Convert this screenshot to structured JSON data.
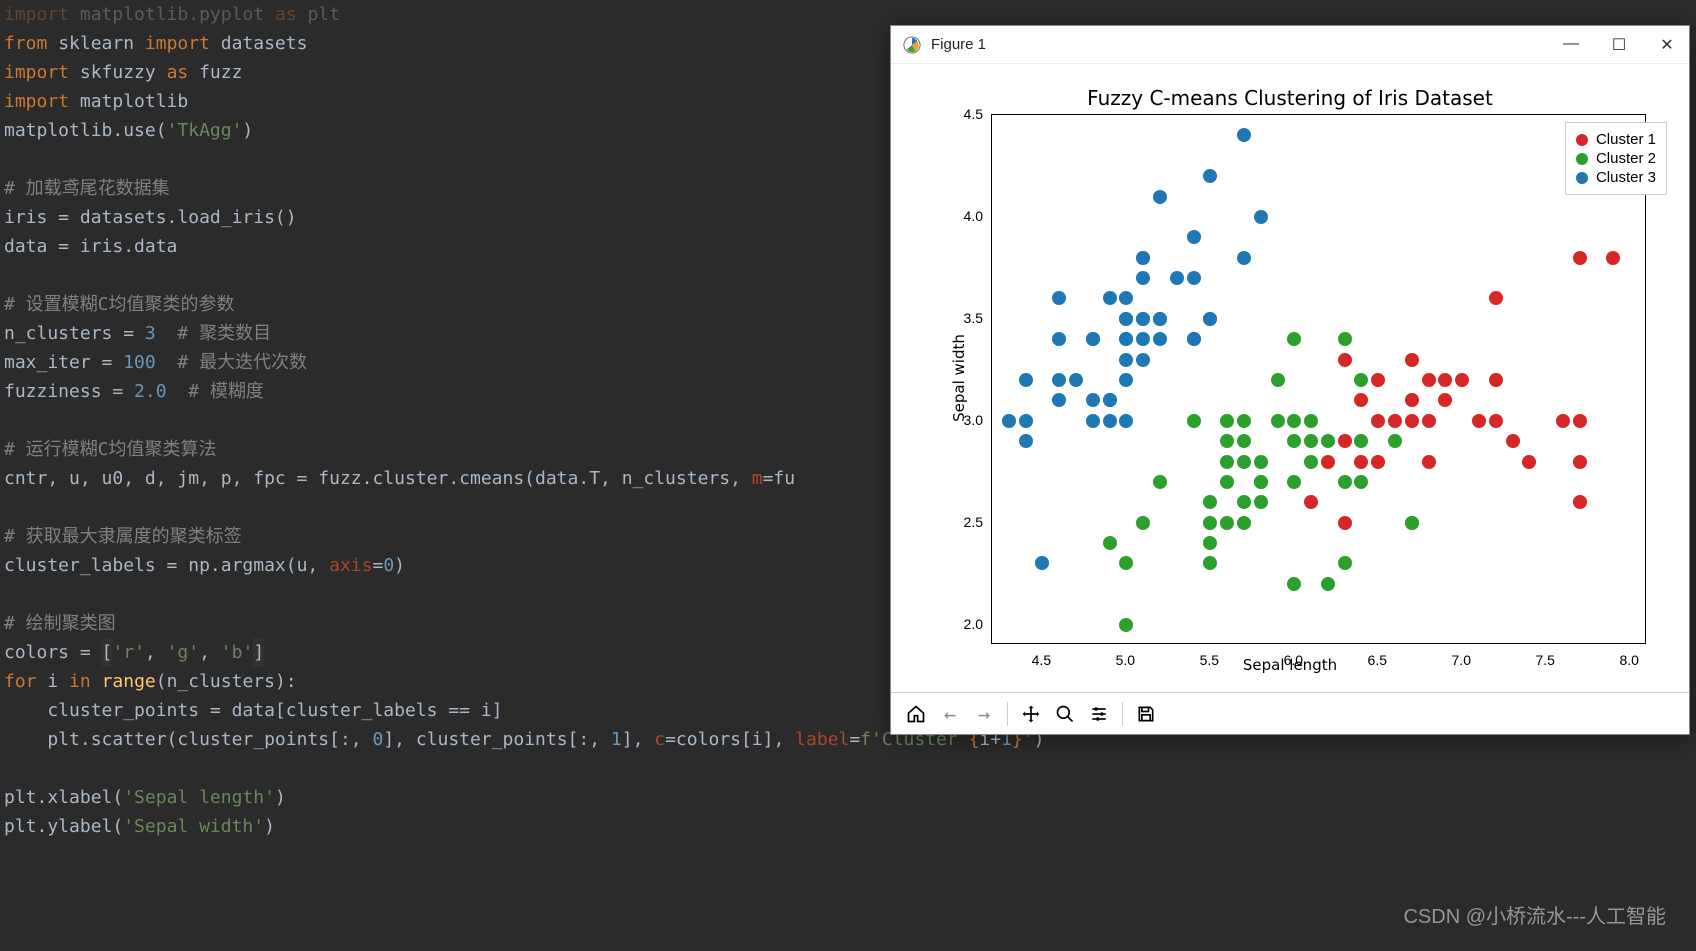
{
  "code": {
    "lines": [
      {
        "t": "import matplotlib.pyplot as plt",
        "tokens": [
          [
            "import ",
            "kw"
          ],
          [
            "matplotlib.pyplot ",
            ""
          ],
          [
            "as ",
            "kw"
          ],
          [
            "plt",
            ""
          ]
        ]
      },
      {
        "t": "from sklearn import datasets",
        "tokens": [
          [
            "from ",
            "kw"
          ],
          [
            "sklearn ",
            ""
          ],
          [
            "import ",
            "kw"
          ],
          [
            "datasets",
            ""
          ]
        ]
      },
      {
        "t": "import skfuzzy as fuzz",
        "tokens": [
          [
            "import ",
            "kw"
          ],
          [
            "skfuzzy ",
            ""
          ],
          [
            "as ",
            "kw"
          ],
          [
            "fuzz",
            ""
          ]
        ]
      },
      {
        "t": "import matplotlib",
        "tokens": [
          [
            "import ",
            "kw"
          ],
          [
            "matplotlib",
            ""
          ]
        ]
      },
      {
        "t": "matplotlib.use('TkAgg')",
        "tokens": [
          [
            "matplotlib.use(",
            ""
          ],
          [
            "'TkAgg'",
            "str"
          ],
          [
            ")",
            ""
          ]
        ]
      },
      {
        "t": "",
        "tokens": []
      },
      {
        "t": "# 加载鸢尾花数据集",
        "tokens": [
          [
            "# 加载鸢尾花数据集",
            "cmt"
          ]
        ]
      },
      {
        "t": "iris = datasets.load_iris()",
        "tokens": [
          [
            "iris = datasets.load_iris()",
            ""
          ]
        ]
      },
      {
        "t": "data = iris.data",
        "tokens": [
          [
            "data = iris.data",
            ""
          ]
        ]
      },
      {
        "t": "",
        "tokens": []
      },
      {
        "t": "# 设置模糊C均值聚类的参数",
        "tokens": [
          [
            "# 设置模糊C均值聚类的参数",
            "cmt"
          ]
        ]
      },
      {
        "t": "n_clusters = 3  # 聚类数目",
        "tokens": [
          [
            "n_clusters = ",
            ""
          ],
          [
            "3",
            "num"
          ],
          [
            "  ",
            ""
          ],
          [
            "# 聚类数目",
            "cmt"
          ]
        ]
      },
      {
        "t": "max_iter = 100  # 最大迭代次数",
        "tokens": [
          [
            "max_iter = ",
            ""
          ],
          [
            "100",
            "num"
          ],
          [
            "  ",
            ""
          ],
          [
            "# 最大迭代次数",
            "cmt"
          ]
        ]
      },
      {
        "t": "fuzziness = 2.0  # 模糊度",
        "tokens": [
          [
            "fuzziness = ",
            ""
          ],
          [
            "2.0",
            "num"
          ],
          [
            "  ",
            ""
          ],
          [
            "# 模糊度",
            "cmt"
          ]
        ]
      },
      {
        "t": "",
        "tokens": []
      },
      {
        "t": "# 运行模糊C均值聚类算法",
        "tokens": [
          [
            "# 运行模糊C均值聚类算法",
            "cmt"
          ]
        ]
      },
      {
        "t": "cntr, u, u0, d, jm, p, fpc = fuzz.cluster.cmeans(data.T, n_clusters, m=fu",
        "tokens": [
          [
            "cntr, u, u0, d, jm, p, fpc = fuzz.cluster.cmeans(data.T, n_clusters, ",
            ""
          ],
          [
            "m",
            "param"
          ],
          [
            "=fu",
            ""
          ]
        ]
      },
      {
        "t": "",
        "tokens": []
      },
      {
        "t": "# 获取最大隶属度的聚类标签",
        "tokens": [
          [
            "# 获取最大隶属度的聚类标签",
            "cmt"
          ]
        ]
      },
      {
        "t": "cluster_labels = np.argmax(u, axis=0)",
        "tokens": [
          [
            "cluster_labels = np.argmax(u, ",
            ""
          ],
          [
            "axis",
            "param"
          ],
          [
            "=",
            ""
          ],
          [
            "0",
            "num"
          ],
          [
            ")",
            ""
          ]
        ]
      },
      {
        "t": "",
        "tokens": []
      },
      {
        "t": "# 绘制聚类图",
        "tokens": [
          [
            "# 绘制聚类图",
            "cmt"
          ]
        ]
      },
      {
        "t": "colors = ['r', 'g', 'b']",
        "tokens": [
          [
            "colors = ",
            ""
          ],
          [
            "[",
            "hl"
          ],
          [
            "'r'",
            "str"
          ],
          [
            ", ",
            ""
          ],
          [
            "'g'",
            "str"
          ],
          [
            ", ",
            ""
          ],
          [
            "'b'",
            "str"
          ],
          [
            "]",
            "hl"
          ]
        ]
      },
      {
        "t": "for i in range(n_clusters):",
        "tokens": [
          [
            "for ",
            "kw"
          ],
          [
            "i ",
            ""
          ],
          [
            "in ",
            "kw"
          ],
          [
            "range",
            "fn"
          ],
          [
            "(n_clusters):",
            ""
          ]
        ]
      },
      {
        "t": "    cluster_points = data[cluster_labels == i]",
        "tokens": [
          [
            "    cluster_points = data[cluster_labels == i]",
            ""
          ]
        ]
      },
      {
        "t": "    plt.scatter(cluster_points[:, 0], cluster_points[:, 1], c=colors[i], label=f'Cluster {i+1}')",
        "tokens": [
          [
            "    plt.scatter(cluster_points[:, ",
            ""
          ],
          [
            "0",
            "num"
          ],
          [
            "], cluster_points[:, ",
            ""
          ],
          [
            "1",
            "num"
          ],
          [
            "], ",
            ""
          ],
          [
            "c",
            "param"
          ],
          [
            "=colors[i], ",
            ""
          ],
          [
            "label",
            "param"
          ],
          [
            "=",
            ""
          ],
          [
            "f'Cluster ",
            "str"
          ],
          [
            "{",
            "kw"
          ],
          [
            "i+",
            ""
          ],
          [
            "1",
            "num"
          ],
          [
            "}",
            "kw"
          ],
          [
            "'",
            "str"
          ],
          [
            ")",
            ""
          ]
        ]
      },
      {
        "t": "",
        "tokens": []
      },
      {
        "t": "plt.xlabel('Sepal length')",
        "tokens": [
          [
            "plt.xlabel(",
            ""
          ],
          [
            "'Sepal length'",
            "str"
          ],
          [
            ")",
            ""
          ]
        ]
      },
      {
        "t": "plt.ylabel('Sepal width')",
        "tokens": [
          [
            "plt.ylabel(",
            ""
          ],
          [
            "'Sepal width'",
            "str"
          ],
          [
            ")",
            ""
          ]
        ]
      }
    ]
  },
  "figure": {
    "window_title": "Figure 1",
    "toolbar_icons": [
      "home",
      "back",
      "forward",
      "|",
      "pan",
      "zoom",
      "configure",
      "|",
      "save"
    ]
  },
  "chart_data": {
    "type": "scatter",
    "title": "Fuzzy C-means Clustering of Iris Dataset",
    "xlabel": "Sepal length",
    "ylabel": "Sepal width",
    "xlim": [
      4.2,
      8.1
    ],
    "ylim": [
      1.9,
      4.5
    ],
    "x_ticks": [
      4.5,
      5.0,
      5.5,
      6.0,
      6.5,
      7.0,
      7.5,
      8.0
    ],
    "y_ticks": [
      2.0,
      2.5,
      3.0,
      3.5,
      4.0,
      4.5
    ],
    "legend": [
      "Cluster 1",
      "Cluster 2",
      "Cluster 3"
    ],
    "colors": [
      "#d62728",
      "#2ca02c",
      "#1f77b4"
    ],
    "series": [
      {
        "name": "Cluster 1",
        "cluster": 0,
        "points": [
          [
            6.3,
            3.3
          ],
          [
            6.5,
            2.8
          ],
          [
            6.7,
            2.5
          ],
          [
            6.7,
            3.0
          ],
          [
            6.8,
            2.8
          ],
          [
            6.9,
            3.1
          ],
          [
            6.9,
            3.2
          ],
          [
            7.0,
            3.2
          ],
          [
            7.1,
            3.0
          ],
          [
            7.2,
            3.0
          ],
          [
            7.2,
            3.2
          ],
          [
            7.2,
            3.6
          ],
          [
            7.3,
            2.9
          ],
          [
            7.4,
            2.8
          ],
          [
            7.6,
            3.0
          ],
          [
            7.7,
            2.6
          ],
          [
            7.7,
            2.8
          ],
          [
            7.7,
            3.0
          ],
          [
            7.7,
            3.8
          ],
          [
            7.9,
            3.8
          ],
          [
            6.4,
            2.8
          ],
          [
            6.5,
            3.0
          ],
          [
            6.5,
            3.2
          ],
          [
            6.3,
            2.5
          ],
          [
            6.3,
            2.9
          ],
          [
            6.7,
            3.1
          ],
          [
            6.7,
            3.3
          ],
          [
            6.8,
            3.0
          ],
          [
            6.8,
            3.2
          ],
          [
            6.4,
            3.1
          ],
          [
            6.1,
            2.6
          ],
          [
            6.2,
            2.8
          ],
          [
            6.6,
            3.0
          ]
        ]
      },
      {
        "name": "Cluster 2",
        "cluster": 1,
        "points": [
          [
            4.9,
            2.4
          ],
          [
            5.0,
            2.0
          ],
          [
            5.0,
            2.3
          ],
          [
            5.1,
            2.5
          ],
          [
            5.2,
            2.7
          ],
          [
            5.4,
            3.0
          ],
          [
            5.5,
            2.3
          ],
          [
            5.5,
            2.4
          ],
          [
            5.5,
            2.5
          ],
          [
            5.5,
            2.6
          ],
          [
            5.6,
            2.5
          ],
          [
            5.6,
            2.7
          ],
          [
            5.6,
            2.9
          ],
          [
            5.6,
            3.0
          ],
          [
            5.7,
            2.5
          ],
          [
            5.7,
            2.6
          ],
          [
            5.7,
            2.8
          ],
          [
            5.7,
            2.9
          ],
          [
            5.7,
            3.0
          ],
          [
            5.8,
            2.6
          ],
          [
            5.8,
            2.7
          ],
          [
            5.8,
            2.8
          ],
          [
            5.9,
            3.0
          ],
          [
            5.9,
            3.2
          ],
          [
            6.0,
            2.2
          ],
          [
            6.0,
            2.7
          ],
          [
            6.0,
            2.9
          ],
          [
            6.0,
            3.0
          ],
          [
            6.0,
            3.4
          ],
          [
            6.1,
            2.8
          ],
          [
            6.1,
            2.9
          ],
          [
            6.1,
            3.0
          ],
          [
            6.2,
            2.2
          ],
          [
            6.2,
            2.9
          ],
          [
            6.3,
            2.3
          ],
          [
            6.3,
            2.7
          ],
          [
            6.4,
            2.7
          ],
          [
            6.4,
            2.9
          ],
          [
            6.4,
            3.2
          ],
          [
            6.6,
            2.9
          ],
          [
            6.7,
            2.5
          ],
          [
            6.3,
            3.4
          ],
          [
            5.8,
            2.7
          ],
          [
            5.6,
            2.8
          ]
        ]
      },
      {
        "name": "Cluster 3",
        "cluster": 2,
        "points": [
          [
            4.3,
            3.0
          ],
          [
            4.4,
            2.9
          ],
          [
            4.4,
            3.0
          ],
          [
            4.4,
            3.2
          ],
          [
            4.5,
            2.3
          ],
          [
            4.6,
            3.1
          ],
          [
            4.6,
            3.2
          ],
          [
            4.6,
            3.4
          ],
          [
            4.6,
            3.6
          ],
          [
            4.7,
            3.2
          ],
          [
            4.8,
            3.0
          ],
          [
            4.8,
            3.1
          ],
          [
            4.8,
            3.4
          ],
          [
            4.9,
            3.0
          ],
          [
            4.9,
            3.1
          ],
          [
            4.9,
            3.6
          ],
          [
            5.0,
            3.0
          ],
          [
            5.0,
            3.2
          ],
          [
            5.0,
            3.3
          ],
          [
            5.0,
            3.4
          ],
          [
            5.0,
            3.5
          ],
          [
            5.0,
            3.6
          ],
          [
            5.1,
            3.3
          ],
          [
            5.1,
            3.4
          ],
          [
            5.1,
            3.5
          ],
          [
            5.1,
            3.7
          ],
          [
            5.1,
            3.8
          ],
          [
            5.2,
            3.4
          ],
          [
            5.2,
            3.5
          ],
          [
            5.2,
            4.1
          ],
          [
            5.3,
            3.7
          ],
          [
            5.4,
            3.4
          ],
          [
            5.4,
            3.7
          ],
          [
            5.4,
            3.9
          ],
          [
            5.5,
            3.5
          ],
          [
            5.5,
            4.2
          ],
          [
            5.7,
            3.8
          ],
          [
            5.7,
            4.4
          ],
          [
            5.8,
            4.0
          ],
          [
            5.1,
            3.8
          ],
          [
            4.8,
            3.4
          ],
          [
            5.0,
            3.4
          ],
          [
            5.4,
            3.4
          ],
          [
            5.2,
            3.5
          ],
          [
            5.5,
            3.5
          ],
          [
            5.1,
            3.5
          ],
          [
            4.9,
            3.1
          ],
          [
            5.0,
            3.5
          ]
        ]
      }
    ]
  },
  "watermark": "CSDN @小桥流水---人工智能"
}
